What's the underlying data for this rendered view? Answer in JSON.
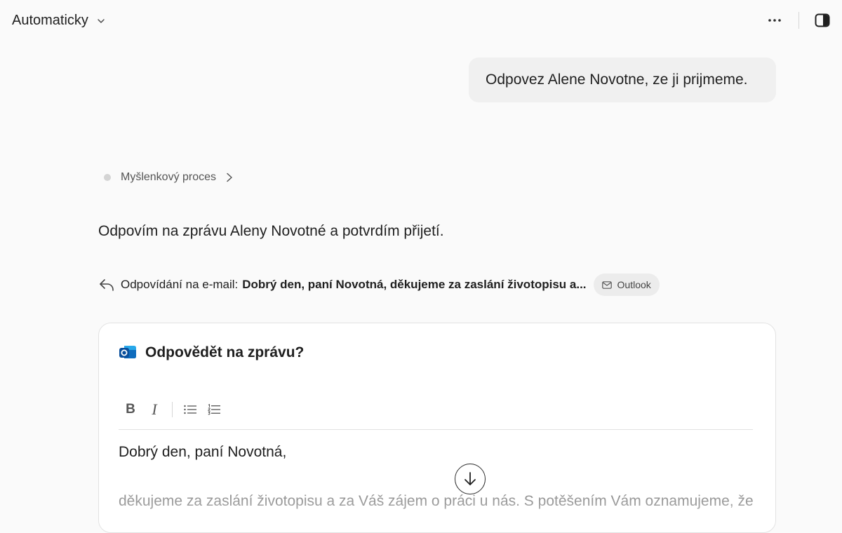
{
  "topbar": {
    "mode_label": "Automaticky",
    "more_icon": "more-horizontal-icon",
    "panel_icon": "side-panel-icon"
  },
  "conversation": {
    "user_message": "Odpovez Alene Novotne, ze ji prijmeme.",
    "thought_label": "Myšlenkový proces",
    "assistant_text": "Odpovím na zprávu Aleny Novotné a potvrdím přijetí.",
    "reply": {
      "prefix": "Odpovídání na e-mail:",
      "subject": "Dobrý den, paní Novotná, děkujeme za zaslání životopisu a...",
      "badge": "Outlook"
    }
  },
  "card": {
    "title": "Odpovědět na zprávu?",
    "toolbar": {
      "bold": "B",
      "italic": "I"
    },
    "greeting": "Dobrý den, paní Novotná,",
    "body": "děkujeme za zaslání životopisu a za Váš zájem o práci u nás. S potěšením Vám oznamujeme, že"
  },
  "colors": {
    "background": "#fafafa",
    "bubble": "#f0f0f0",
    "outlook_blue": "#0f6cbd"
  }
}
